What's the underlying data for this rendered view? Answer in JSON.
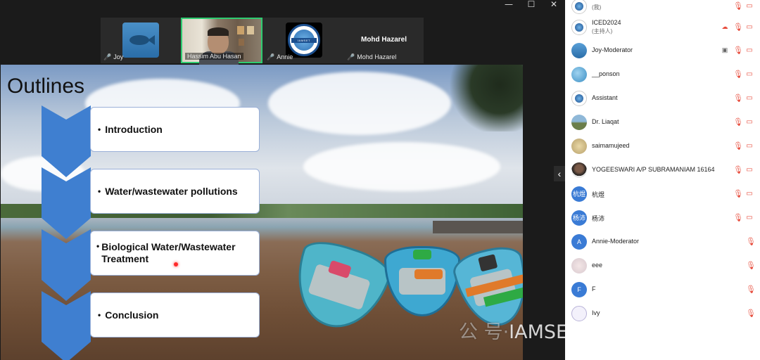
{
  "window": {
    "minimize": "—",
    "maximize": "☐",
    "close": "✕"
  },
  "gallery": {
    "tiles": [
      {
        "name": "Joy"
      },
      {
        "name": "Hassim Abu Hasan"
      },
      {
        "name": "Annie"
      },
      {
        "name": "Mohd Hazarel",
        "display_name": "Mohd Hazarel"
      }
    ],
    "logo_text": "IAMSET"
  },
  "slide": {
    "title": "Outlines",
    "items": [
      {
        "bullet": "•",
        "text": "Introduction"
      },
      {
        "bullet": "•",
        "text": "Water/wastewater pollutions"
      },
      {
        "bullet": "•",
        "text": "Biological Water/Wastewater Treatment"
      },
      {
        "bullet": "•",
        "text": "Conclusion"
      }
    ]
  },
  "panel": {
    "collapse_icon": "‹",
    "participants": [
      {
        "name": "",
        "sub": "(我)",
        "avatar": "logo",
        "mic": true,
        "video": true
      },
      {
        "name": "ICED2024",
        "sub": "(主持人)",
        "avatar": "logo",
        "mic": true,
        "video": true,
        "extra": "cloud-icon"
      },
      {
        "name": "Joy-Moderator",
        "avatar": "fish",
        "mic": true,
        "video": true,
        "extra": "screen-icon"
      },
      {
        "name": "__ponson",
        "avatar": "photo-blue",
        "mic": true,
        "video": true
      },
      {
        "name": "Assistant",
        "avatar": "logo",
        "mic": true,
        "video": true
      },
      {
        "name": "Dr. Liaqat",
        "avatar": "photo-landscape",
        "mic": true,
        "video": true
      },
      {
        "name": "saimamujeed",
        "avatar": "photo-flower",
        "mic": true,
        "video": true
      },
      {
        "name": "YOGEESWARI A/P SUBRAMANIAM 16164",
        "avatar": "photo-person",
        "mic": true,
        "video": true
      },
      {
        "name": "杭煜",
        "avatar": "text",
        "avatar_text": "杭煜",
        "avatar_color": "#3a7bd5",
        "mic": true,
        "video": true
      },
      {
        "name": "杨沛",
        "avatar": "text",
        "avatar_text": "杨沛",
        "avatar_color": "#3a7bd5",
        "mic": true,
        "video": true
      },
      {
        "name": "Annie-Moderator",
        "avatar": "text",
        "avatar_text": "A",
        "avatar_color": "#3a7bd5",
        "mic": true,
        "video": false
      },
      {
        "name": "eee",
        "avatar": "photo-pale",
        "mic": true,
        "video": false
      },
      {
        "name": "F",
        "avatar": "text",
        "avatar_text": "F",
        "avatar_color": "#3a7bd5",
        "mic": true,
        "video": false
      },
      {
        "name": "Ivy",
        "avatar": "photo-sketch",
        "mic": true,
        "video": false
      }
    ]
  },
  "watermark": {
    "prefix": "公 号·",
    "text": "IAMSET学术服务"
  }
}
